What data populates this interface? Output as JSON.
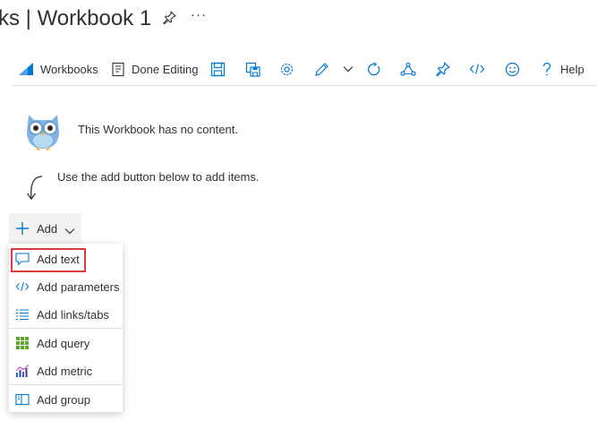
{
  "header": {
    "title": "ks | Workbook 1",
    "pin_icon": "pin-icon",
    "more_icon": "more-icon",
    "more_glyph": "···"
  },
  "toolbar": {
    "workbooks_label": "Workbooks",
    "done_editing_label": "Done Editing",
    "help_label": "Help",
    "icons": [
      "workbooks-icon",
      "done-editing-icon",
      "save-icon",
      "save-as-icon",
      "settings-icon",
      "edit-icon",
      "chevron-down-icon",
      "refresh-icon",
      "share-icon",
      "pin-icon",
      "code-icon",
      "feedback-icon",
      "help-icon"
    ]
  },
  "empty_state": {
    "message": "This Workbook has no content.",
    "hint": "Use the add button below to add items."
  },
  "add_button": {
    "label": "Add"
  },
  "add_menu": {
    "items": [
      {
        "label": "Add text",
        "icon": "comment-icon"
      },
      {
        "label": "Add parameters",
        "icon": "code-icon"
      },
      {
        "label": "Add links/tabs",
        "icon": "list-icon"
      },
      {
        "label": "Add query",
        "icon": "grid-icon"
      },
      {
        "label": "Add metric",
        "icon": "metric-chart-icon"
      },
      {
        "label": "Add group",
        "icon": "group-icon"
      }
    ],
    "highlighted_item": "Add text"
  },
  "colors": {
    "accent": "#0078d4",
    "highlight_border": "#e0393e",
    "text": "#323130",
    "add_button_bg": "#f3f2f1"
  }
}
